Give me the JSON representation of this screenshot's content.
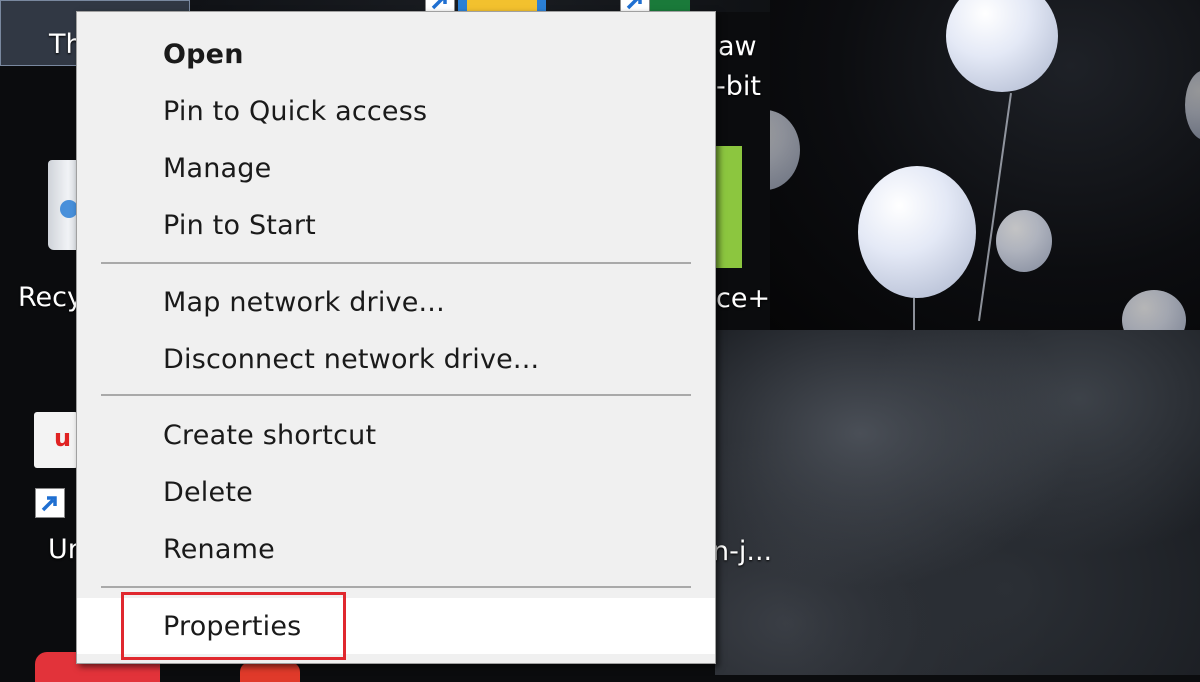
{
  "desktop": {
    "icons": [
      {
        "name": "This PC",
        "label": "Th"
      },
      {
        "name": "Recycle Bin",
        "label": "Recy"
      },
      {
        "name": "Uninstaller shortcut",
        "label": "Ur"
      },
      {
        "name": "app-shortcut-draw",
        "label_line1": "aw",
        "label_line2": "-bit"
      },
      {
        "name": "app-shortcut-green",
        "label": "ce+"
      },
      {
        "name": "app-shortcut-bottom",
        "label": "n-j..."
      }
    ]
  },
  "context_menu": {
    "groups": [
      [
        {
          "label": "Open",
          "bold": true
        },
        {
          "label": "Pin to Quick access"
        },
        {
          "label": "Manage"
        },
        {
          "label": "Pin to Start"
        }
      ],
      [
        {
          "label": "Map network drive..."
        },
        {
          "label": "Disconnect network drive..."
        }
      ],
      [
        {
          "label": "Create shortcut"
        },
        {
          "label": "Delete"
        },
        {
          "label": "Rename"
        }
      ],
      [
        {
          "label": "Properties",
          "highlighted": true
        }
      ]
    ]
  },
  "colors": {
    "menu_background": "#f0f0f0",
    "highlight_box": "#e0282e",
    "separator": "#a9a9a9"
  }
}
